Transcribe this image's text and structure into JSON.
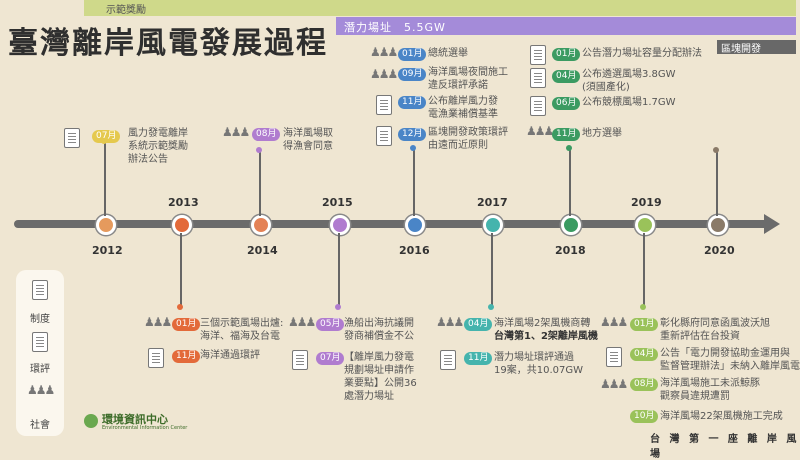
{
  "header": {
    "demo_award": "示範獎勵",
    "potential_sites": "潛力場址　5.5GW",
    "block_dev": "區塊開發",
    "title": "臺灣離岸風電發展過程"
  },
  "years": [
    {
      "label": "2012",
      "color": "#e59a5d"
    },
    {
      "label": "2013",
      "color": "#e36a3a"
    },
    {
      "label": "2014",
      "color": "#e48256"
    },
    {
      "label": "2015",
      "color": "#b07ccf"
    },
    {
      "label": "2016",
      "color": "#4a85c7"
    },
    {
      "label": "2017",
      "color": "#45b4ad"
    },
    {
      "label": "2018",
      "color": "#3b9b62"
    },
    {
      "label": "2019",
      "color": "#9ac25a"
    },
    {
      "label": "2020",
      "color": "#8a7a68"
    }
  ],
  "events": {
    "e1": {
      "month": "07月",
      "text1": "風力發電離岸",
      "text2": "系統示範獎勵",
      "text3": "辦法公告",
      "color": "#e5c94e"
    },
    "e2": {
      "month": "08月",
      "text1": "海洋風場取",
      "text2": "得漁會同意",
      "color": "#b07ccf"
    },
    "e3": {
      "month": "01月",
      "text1": "總統選舉",
      "color": "#4a85c7"
    },
    "e4": {
      "month": "09月",
      "text1": "海洋風場夜間施工",
      "text2": "違反環評承諾",
      "color": "#4a85c7"
    },
    "e5": {
      "month": "11月",
      "text1": "公布離岸風力發",
      "text2": "電漁業補償基準",
      "color": "#4a85c7"
    },
    "e6": {
      "month": "12月",
      "text1": "區塊開發政策環評",
      "text2": "由遠而近原則",
      "color": "#4a85c7"
    },
    "e7": {
      "month": "01月",
      "text1": "公告潛力場址容量分配辦法",
      "color": "#3b9b62"
    },
    "e8": {
      "month": "04月",
      "text1": "公布遴選風場3.8GW",
      "text2": "(須國產化)",
      "color": "#3b9b62"
    },
    "e9": {
      "month": "06月",
      "text1": "公布競標風場1.7GW",
      "color": "#3b9b62"
    },
    "e10": {
      "month": "11月",
      "text1": "地方選舉",
      "color": "#3b9b62"
    },
    "e11": {
      "month": "01月",
      "text1": "三個示範風場出爐:",
      "text2": "海洋、福海及台電",
      "color": "#e36a3a"
    },
    "e12": {
      "month": "11月",
      "text1": "海洋通過環評",
      "color": "#e36a3a"
    },
    "e13": {
      "month": "05月",
      "text1": "漁船出海抗議開",
      "text2": "發商補償金不公",
      "color": "#b07ccf"
    },
    "e14": {
      "month": "07月",
      "text1": "【離岸風力發電",
      "text2": "規劃場址申請作",
      "text3": "業要點】公開36",
      "text4": "處潛力場址",
      "color": "#b07ccf"
    },
    "e15": {
      "month": "04月",
      "text1": "海洋風場2架風機商轉",
      "text2": "台灣第1、2架離岸風機",
      "color": "#45b4ad"
    },
    "e16": {
      "month": "11月",
      "text1": "潛力場址環評通過",
      "text2": "19案，共10.07GW",
      "color": "#45b4ad"
    },
    "e17": {
      "month": "01月",
      "text1": "彰化縣府同意函風波沃旭",
      "text2": "重新評估在台投資",
      "color": "#9ac25a"
    },
    "e18": {
      "month": "04月",
      "text1": "公告「電力開發協助金運用與",
      "text2": "監督管理辦法」未納入離岸風電",
      "color": "#9ac25a"
    },
    "e19": {
      "month": "08月",
      "text1": "海洋風場施工未派鯨豚",
      "text2": "觀察員違規遭罰",
      "color": "#9ac25a"
    },
    "e20": {
      "month": "10月",
      "text1": "海洋風場22架風機施工完成",
      "text2": "台 灣 第 一 座 離 岸 風 場",
      "color": "#9ac25a"
    }
  },
  "legend": {
    "system": "制度",
    "env": "環評",
    "society": "社會"
  },
  "logo": {
    "name": "環境資訊中心",
    "sub": "Environmental Information Center"
  }
}
